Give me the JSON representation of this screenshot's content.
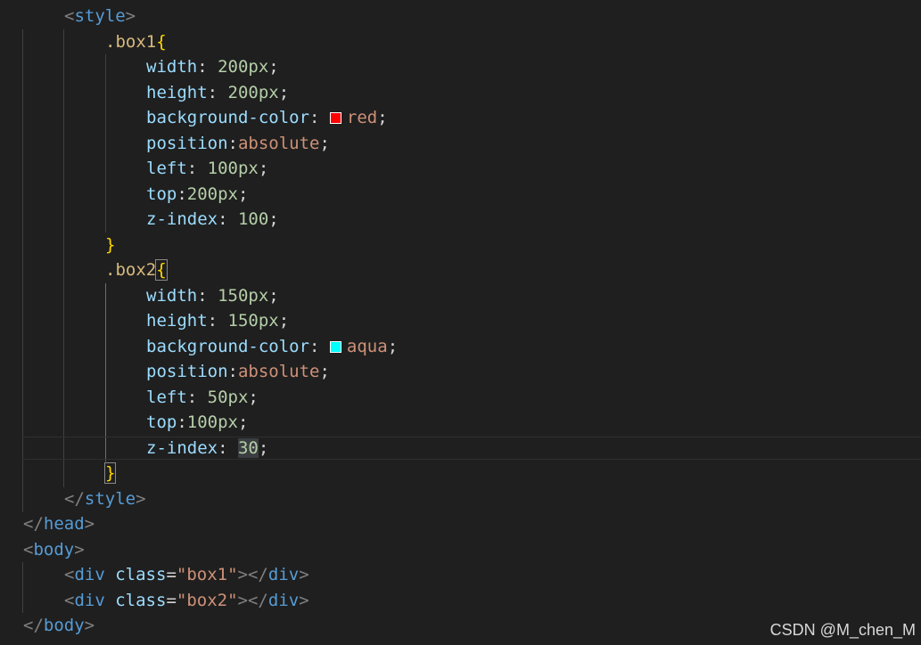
{
  "code": {
    "style_open": {
      "lt": "<",
      "name": "style",
      "gt": ">"
    },
    "box1": {
      "selector": ".box1",
      "brace_open": "{",
      "brace_close": "}",
      "props": [
        {
          "name": "width",
          "sep": ": ",
          "value": "200px",
          "end": ";"
        },
        {
          "name": "height",
          "sep": ": ",
          "value": "200px",
          "end": ";"
        },
        {
          "name": "background-color",
          "sep": ": ",
          "value": "red",
          "end": ";",
          "swatch": "#ff0000"
        },
        {
          "name": "position",
          "sep": ":",
          "value": "absolute",
          "end": ";"
        },
        {
          "name": "left",
          "sep": ": ",
          "value": "100px",
          "end": ";"
        },
        {
          "name": "top",
          "sep": ":",
          "value": "200px",
          "end": ";"
        },
        {
          "name": "z-index",
          "sep": ": ",
          "value": "100",
          "end": ";"
        }
      ]
    },
    "box2": {
      "selector": ".box2",
      "brace_open": "{",
      "brace_close": "}",
      "props": [
        {
          "name": "width",
          "sep": ": ",
          "value": "150px",
          "end": ";"
        },
        {
          "name": "height",
          "sep": ": ",
          "value": "150px",
          "end": ";"
        },
        {
          "name": "background-color",
          "sep": ": ",
          "value": "aqua",
          "end": ";",
          "swatch": "#00ffff"
        },
        {
          "name": "position",
          "sep": ":",
          "value": "absolute",
          "end": ";"
        },
        {
          "name": "left",
          "sep": ": ",
          "value": "50px",
          "end": ";"
        },
        {
          "name": "top",
          "sep": ":",
          "value": "100px",
          "end": ";"
        },
        {
          "name": "z-index",
          "sep": ": ",
          "value": "30",
          "end": ";"
        }
      ]
    },
    "style_close": {
      "lt": "</",
      "name": "style",
      "gt": ">"
    },
    "head_close": {
      "lt": "</",
      "name": "head",
      "gt": ">"
    },
    "body_open": {
      "lt": "<",
      "name": "body",
      "gt": ">"
    },
    "div1": {
      "lt": "<",
      "name": "div",
      "attr": "class",
      "eq": "=",
      "value": "\"box1\"",
      "gt": ">",
      "close_lt": "</",
      "close_gt": ">"
    },
    "div2": {
      "lt": "<",
      "name": "div",
      "attr": "class",
      "eq": "=",
      "value": "\"box2\"",
      "gt": ">",
      "close_lt": "</",
      "close_gt": ">"
    },
    "body_close": {
      "lt": "</",
      "name": "body",
      "gt": ">"
    }
  },
  "watermark": "CSDN @M_chen_M"
}
